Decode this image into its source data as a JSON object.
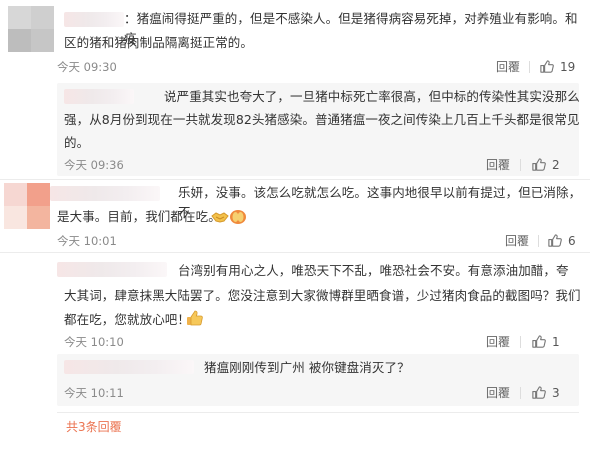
{
  "comments": [
    {
      "text_lines": [
        "：猪瘟闹得挺严重的，但是不感染人。但是猪得病容易死掉，对养殖业有影响。和疫",
        "区的猪和猪肉制品隔离挺正常的。"
      ],
      "time": "今天 09:30",
      "reply_label": "回覆",
      "likes": "19"
    },
    {
      "text_lines": [
        "说严重其实也夸大了，一旦猪中标死亡率很高，但中标的传染性其实没那么",
        "强，从8月份到现在一共就发现82头猪感染。普通猪瘟一夜之间传染上几百上千头都是很常见",
        "的。"
      ],
      "time": "今天 09:36",
      "reply_label": "回覆",
      "likes": "2"
    },
    {
      "text_lines": [
        "乐妍，没事。该怎么吃就怎么吃。这事内地很早以前有提过，但已消除，不",
        "是大事。目前，我们都在吃。"
      ],
      "time": "今天 10:01",
      "reply_label": "回覆",
      "likes": "6"
    },
    {
      "text_lines": [
        "台湾别有用心之人，唯恐天下不乱，唯恐社会不安。有意添油加醋，夸",
        "大其词，肆意抹黑大陆罢了。您没注意到大家微博群里晒食谱，少过猪肉食品的截图吗？我们",
        "都在吃，您就放心吧！"
      ],
      "time": "今天 10:10",
      "reply_label": "回覆",
      "likes": "1"
    },
    {
      "text_lines": [
        "猪瘟刚刚传到广州 被你键盘消灭了？"
      ],
      "time": "今天 10:11",
      "reply_label": "回覆",
      "likes": "3"
    }
  ],
  "footer": {
    "more_replies": "共3条回覆"
  },
  "icons": {
    "like": "thumbs-up-icon",
    "emoji_handshake": "handshake-emoji-icon",
    "emoji_pray": "pray-emoji-icon",
    "emoji_thumbsup": "thumbs-up-emoji-icon"
  },
  "colors": {
    "link": "#eb7350",
    "meta": "#8a8a8a",
    "text": "#333333",
    "panel": "#f6f6f6"
  }
}
